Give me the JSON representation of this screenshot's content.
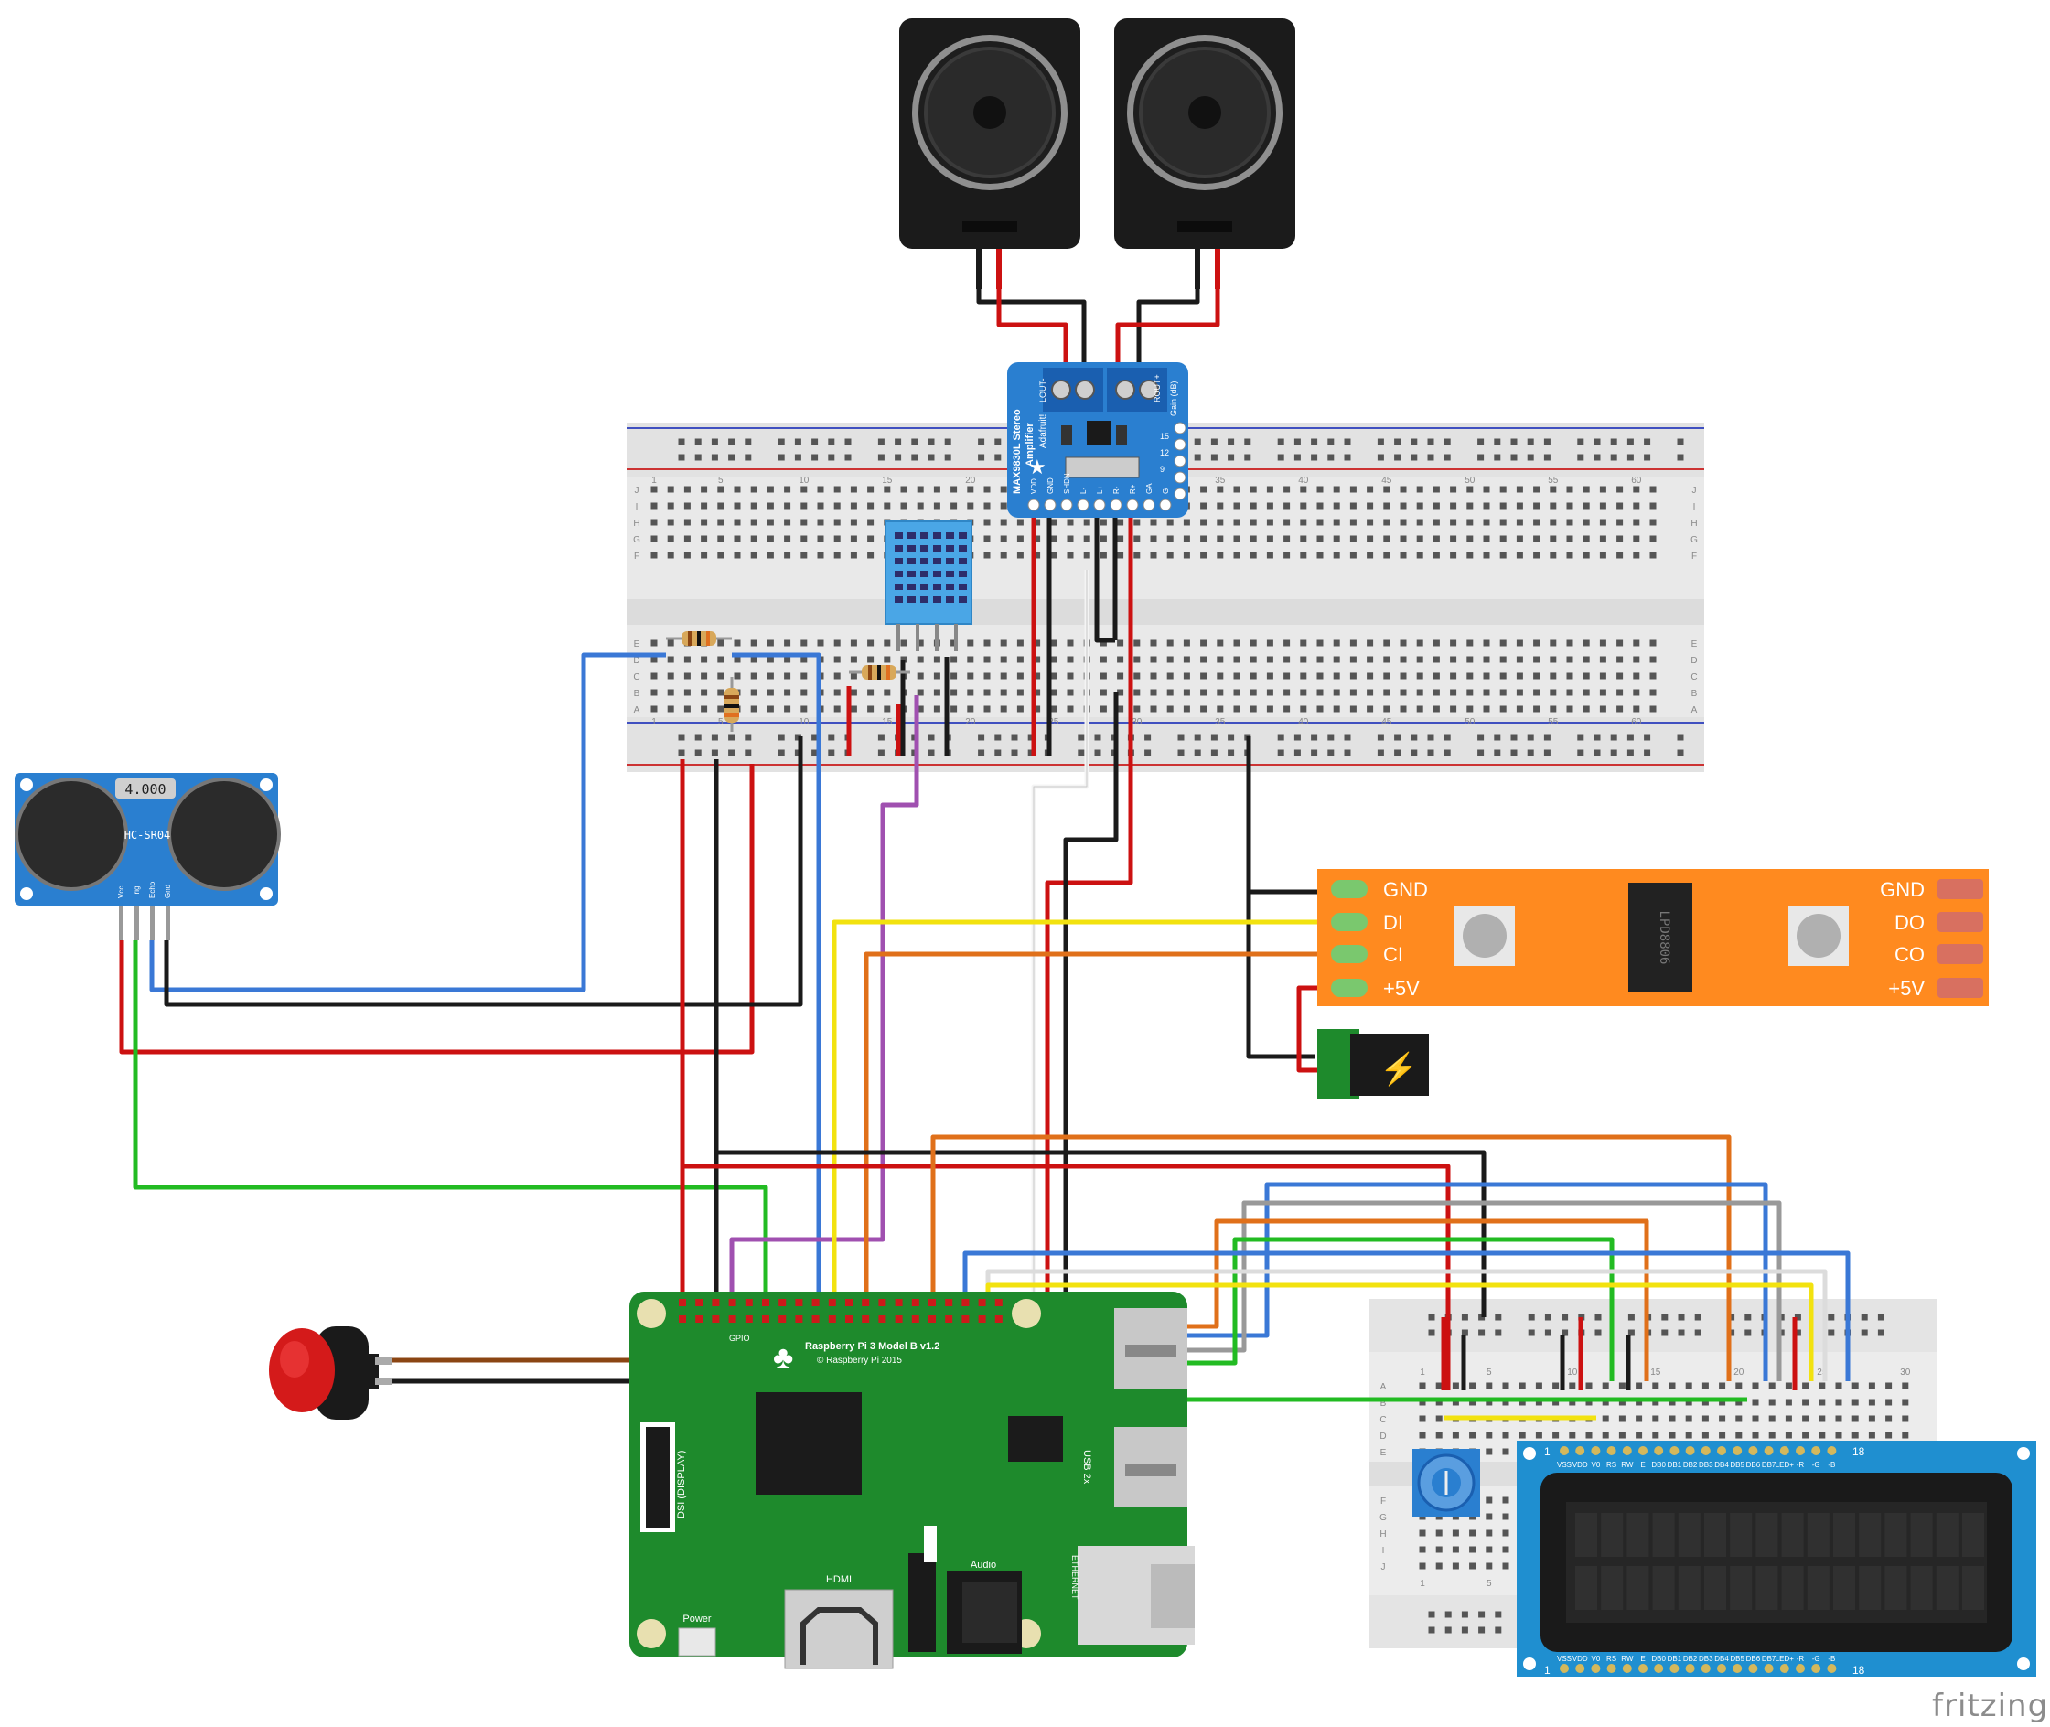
{
  "ultrasonic": {
    "display": "4.000",
    "model": "HC-SR04",
    "pins": [
      "Vcc",
      "Trig",
      "Echo",
      "Gnd"
    ]
  },
  "amplifier": {
    "title": "MAX9830L Stereo",
    "subtitle": "Amplifier",
    "brand": "Adafruit!",
    "lout": "LOUT-",
    "rout": "ROUT+",
    "gain": "Gain (dB)",
    "gain_values": [
      "15",
      "12",
      "9"
    ],
    "pins": [
      "VDD",
      "GND",
      "SHDN",
      "L-",
      "L+",
      "R-",
      "R+",
      "GA",
      "G"
    ]
  },
  "led_strip": {
    "left_labels": [
      "GND",
      "DI",
      "CI",
      "+5V"
    ],
    "right_labels": [
      "GND",
      "DO",
      "CO",
      "+5V"
    ],
    "chip": "LPD8806"
  },
  "raspberry_pi": {
    "model": "Raspberry Pi 3 Model B v1.2",
    "copyright": "© Raspberry Pi 2015",
    "gpio": "GPIO",
    "dsi": "DSI (DISPLAY)",
    "hdmi": "HDMI",
    "power": "Power",
    "audio": "Audio",
    "usb": "USB 2x",
    "ethernet": "ETHERNET"
  },
  "lcd": {
    "pins": [
      "VSS",
      "VDD",
      "V0",
      "RS",
      "RW",
      "E",
      "DB0",
      "DB1",
      "DB2",
      "DB3",
      "DB4",
      "DB5",
      "DB6",
      "DB7",
      "LED+",
      "-R",
      "-G",
      "-B"
    ],
    "first": "1",
    "last": "18"
  },
  "breadboard_main": {
    "numbers": [
      "1",
      "5",
      "10",
      "15",
      "20",
      "25",
      "30",
      "35",
      "40",
      "45",
      "50",
      "55",
      "60"
    ],
    "rows_top": [
      "J",
      "I",
      "H",
      "G",
      "F"
    ],
    "rows_bottom": [
      "E",
      "D",
      "C",
      "B",
      "A"
    ]
  },
  "breadboard_small": {
    "numbers": [
      "1",
      "5",
      "10",
      "15",
      "20",
      "25",
      "30"
    ],
    "rows": [
      "A",
      "B",
      "C",
      "D",
      "E",
      "F",
      "G",
      "H",
      "I",
      "J"
    ]
  },
  "logo": "fritzing",
  "colors": {
    "wire_red": "#cc1111",
    "wire_black": "#1a1a1a",
    "wire_blue": "#3a78d6",
    "wire_green": "#22bb22",
    "wire_yellow": "#f2e20f",
    "wire_orange": "#e0701a",
    "wire_purple": "#a050b0",
    "wire_white": "#f4f4f4",
    "wire_gray": "#999999",
    "wire_brown": "#8b4513",
    "pcb_green": "#1e8a2c",
    "module_blue": "#2a7fd0",
    "strip_orange": "#ff8a1f",
    "lcd_blue": "#1f8fd0"
  }
}
